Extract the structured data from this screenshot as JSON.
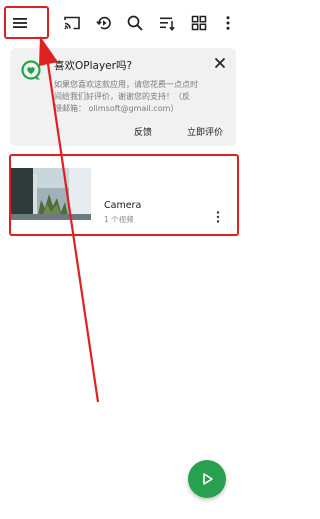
{
  "app": {
    "name": "OPlayer"
  },
  "toolbar": {
    "icons": [
      "menu-icon",
      "cast-icon",
      "history-icon",
      "search-icon",
      "sort-icon",
      "grid-view-icon",
      "more-vert-icon"
    ]
  },
  "rating_card": {
    "title": "喜欢OPlayer吗?",
    "body_lines": [
      "如果您喜欢这款应用，请您花费一点点时",
      "间给我们好评价，谢谢您的支持！（反",
      "馈邮箱： olimsoft@gmail.com）"
    ],
    "feedback_label": "反馈",
    "rate_label": "立即评价"
  },
  "folders": [
    {
      "name": "Camera",
      "count": "1 个视频"
    }
  ],
  "colors": {
    "accent": "#27a150",
    "annotation": "#e02020",
    "card_bg": "#f1f1f1"
  }
}
